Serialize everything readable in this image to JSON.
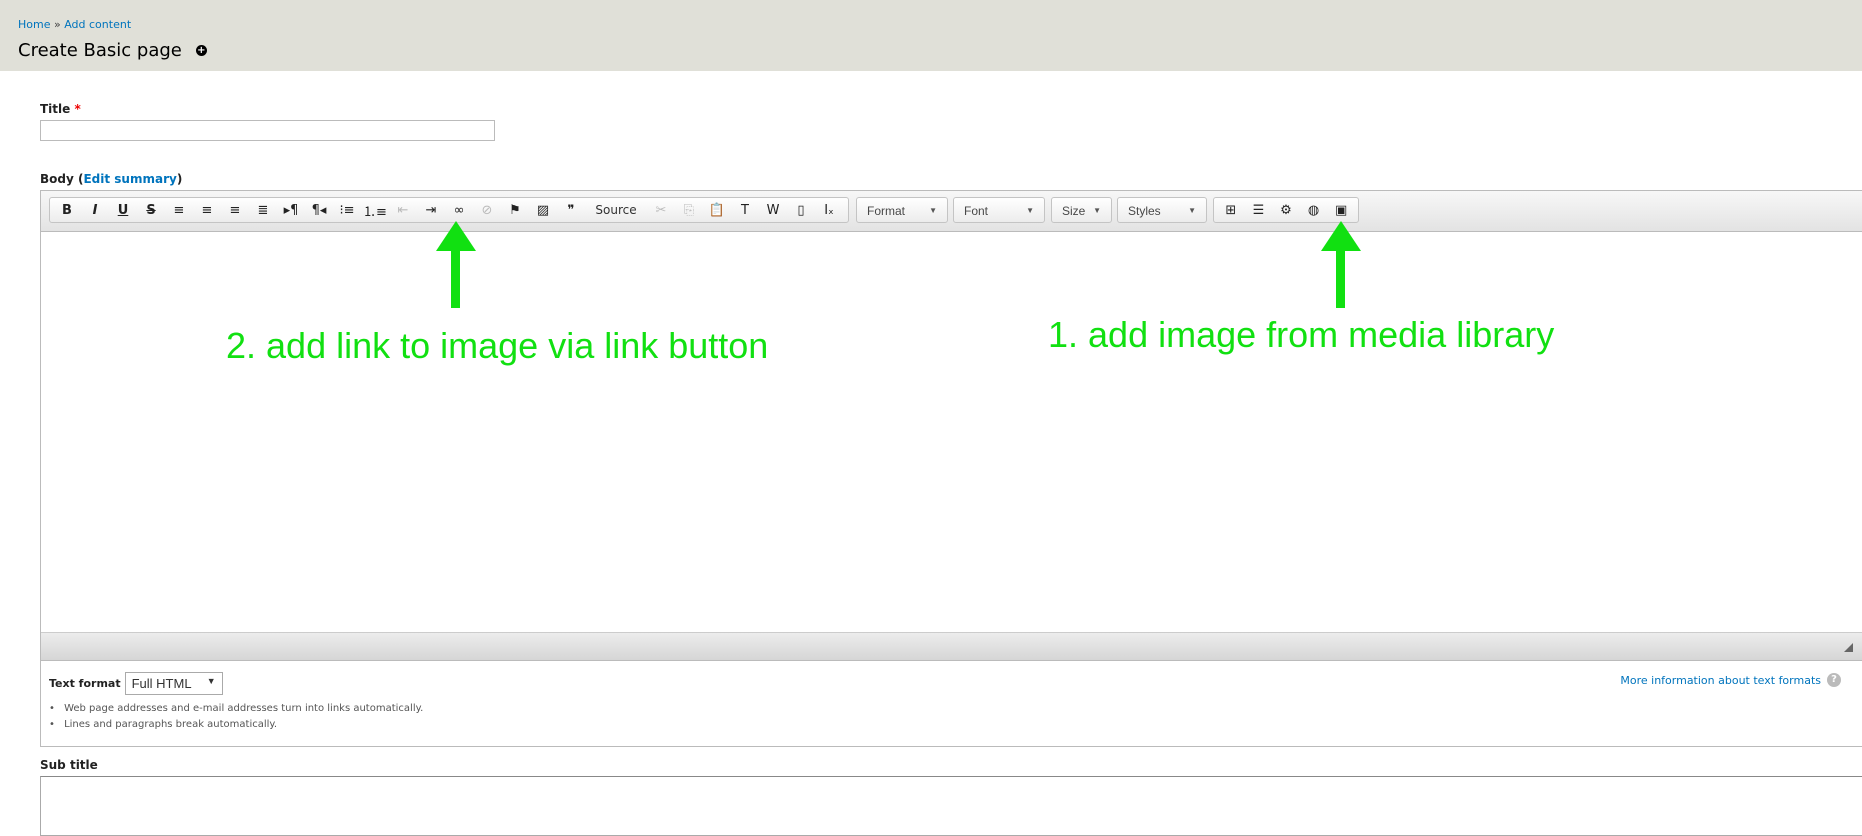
{
  "breadcrumb": {
    "home": "Home",
    "separator": "»",
    "current": "Add content"
  },
  "page_title": "Create Basic page",
  "title_field": {
    "label": "Title",
    "required_mark": "*",
    "value": ""
  },
  "body_field": {
    "label": "Body (",
    "edit_summary": "Edit summary",
    "close": ")"
  },
  "toolbar": {
    "buttons": [
      {
        "icon": "bold-icon",
        "glyph": "B"
      },
      {
        "icon": "italic-icon",
        "glyph": "I"
      },
      {
        "icon": "underline-icon",
        "glyph": "U"
      },
      {
        "icon": "strikethrough-icon",
        "glyph": "S"
      },
      {
        "icon": "align-left-icon",
        "glyph": "≡"
      },
      {
        "icon": "align-center-icon",
        "glyph": "≡"
      },
      {
        "icon": "align-right-icon",
        "glyph": "≡"
      },
      {
        "icon": "justify-icon",
        "glyph": "≣"
      },
      {
        "icon": "ltr-icon",
        "glyph": "▸¶"
      },
      {
        "icon": "rtl-icon",
        "glyph": "¶◂"
      },
      {
        "icon": "bulleted-list-icon",
        "glyph": "⁝≡"
      },
      {
        "icon": "numbered-list-icon",
        "glyph": "⒈≡"
      },
      {
        "icon": "outdent-icon",
        "glyph": "⇤",
        "disabled": true
      },
      {
        "icon": "indent-icon",
        "glyph": "⇥"
      },
      {
        "icon": "link-icon",
        "glyph": "∞"
      },
      {
        "icon": "unlink-icon",
        "glyph": "⊘",
        "disabled": true
      },
      {
        "icon": "anchor-flag-icon",
        "glyph": "⚑"
      },
      {
        "icon": "image-icon",
        "glyph": "▨"
      },
      {
        "icon": "blockquote-icon",
        "glyph": "❞"
      }
    ],
    "source_label": "Source",
    "buttons2": [
      {
        "icon": "cut-icon",
        "glyph": "✂",
        "disabled": true
      },
      {
        "icon": "copy-icon",
        "glyph": "⎘",
        "disabled": true
      },
      {
        "icon": "paste-icon",
        "glyph": "📋"
      },
      {
        "icon": "paste-text-icon",
        "glyph": "T"
      },
      {
        "icon": "paste-word-icon",
        "glyph": "W"
      },
      {
        "icon": "template-icon",
        "glyph": "▯"
      },
      {
        "icon": "remove-format-icon",
        "glyph": "Iₓ"
      }
    ],
    "combos": {
      "format": "Format",
      "font": "Font",
      "size": "Size",
      "styles": "Styles"
    },
    "buttons3": [
      {
        "icon": "table-icon",
        "glyph": "⊞"
      },
      {
        "icon": "show-blocks-icon",
        "glyph": "☰"
      },
      {
        "icon": "embed-icon",
        "glyph": "⚙"
      },
      {
        "icon": "globe-icon",
        "glyph": "◍"
      },
      {
        "icon": "media-library-icon",
        "glyph": "▣"
      }
    ]
  },
  "text_format": {
    "label": "Text format",
    "selected": "Full HTML",
    "tips": [
      "Web page addresses and e-mail addresses turn into links automatically.",
      "Lines and paragraphs break automatically."
    ],
    "more_link": "More information about text formats",
    "help_glyph": "?"
  },
  "subtitle_field": {
    "label": "Sub title",
    "value": ""
  },
  "annotations": {
    "step2": "2. add link to image via link button",
    "step1": "1. add image from media library",
    "color": "#11e011"
  }
}
